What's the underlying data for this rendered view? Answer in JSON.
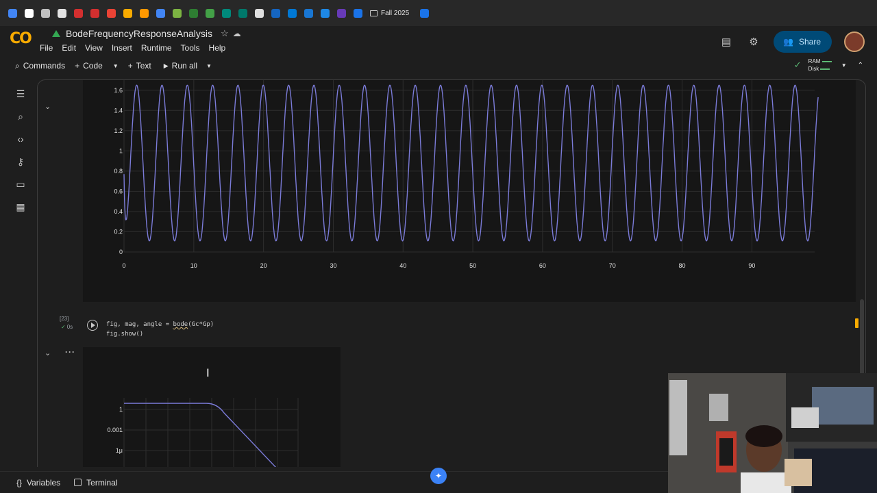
{
  "bookmarks": {
    "folder_label": "Fall 2025",
    "colors": [
      "#4285f4",
      "#ffffff",
      "#c0c0c0",
      "#e3e3e3",
      "#d32f2f",
      "#d32f2f",
      "#ea4335",
      "#f9ab00",
      "#ff9800",
      "#4285f4",
      "#7cb342",
      "#2e7d32",
      "#43a047",
      "#00897b",
      "#00796b",
      "#e0e0e0",
      "#1565c0",
      "#0078d4",
      "#1976d2",
      "#1e88e5",
      "#673ab7",
      "#1a73e8"
    ]
  },
  "app": {
    "doc_title": "BodeFrequencyResponseAnalysis",
    "menu": [
      "File",
      "Edit",
      "View",
      "Insert",
      "Runtime",
      "Tools",
      "Help"
    ],
    "share_label": "Share"
  },
  "toolbar": {
    "commands_label": "Commands",
    "code_label": "Code",
    "text_label": "Text",
    "run_all_label": "Run all",
    "ram_label": "RAM",
    "disk_label": "Disk"
  },
  "cell": {
    "execution_count": "[23]",
    "exec_time": "0s",
    "code_line1_a": "fig, mag, angle = ",
    "code_line1_fn": "bode",
    "code_line1_b": "(Gc*Gp)",
    "code_line2": "fig.show()"
  },
  "bottom": {
    "variables_label": "Variables",
    "terminal_label": "Terminal"
  },
  "chart_data": [
    {
      "type": "line",
      "description_series_color": "#7b7bd8",
      "x_tick_labels": [
        "0",
        "10",
        "20",
        "30",
        "40",
        "50",
        "60",
        "70",
        "80",
        "90"
      ],
      "y_tick_labels": [
        "0",
        "0.2",
        "0.4",
        "0.6",
        "0.8",
        "1",
        "1.2",
        "1.4",
        "1.6"
      ],
      "xlim": [
        0,
        99
      ],
      "ylim": [
        0,
        1.7
      ],
      "grid": true,
      "series": [
        {
          "shape": "sinusoid",
          "offset": 0.88,
          "amplitude": 0.77,
          "period": 3.63,
          "start_y": 0,
          "x_start": 0,
          "x_end": 99.5
        }
      ]
    },
    {
      "type": "line",
      "y_tick_labels": [
        "1",
        "0.001",
        "1μ"
      ],
      "x_log": true,
      "y_log": true,
      "grid": true,
      "series": [
        {
          "shape": "lowpass",
          "flat_gain": 1,
          "roll_off": "drops after corner"
        }
      ]
    }
  ]
}
